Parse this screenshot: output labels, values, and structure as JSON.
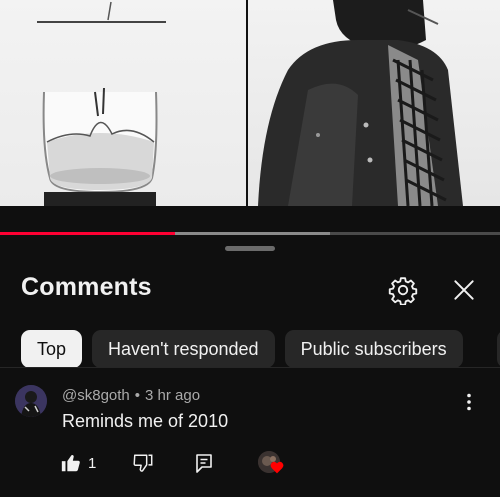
{
  "video": {
    "progress_fraction": 0.35,
    "buffered_fraction": 0.66
  },
  "comments_panel": {
    "title": "Comments",
    "icons": {
      "settings": "gear-icon",
      "close": "close-icon"
    },
    "filters": [
      {
        "label": "Top",
        "selected": true
      },
      {
        "label": "Haven't responded",
        "selected": false
      },
      {
        "label": "Public subscribers",
        "selected": false
      }
    ]
  },
  "comments": [
    {
      "author": "@sk8goth",
      "separator": "•",
      "time": "3 hr ago",
      "text": "Reminds me of 2010",
      "like_count": "1",
      "icons": {
        "like": "thumbs-up-icon",
        "dislike": "thumbs-down-icon",
        "reply": "reply-icon",
        "more": "more-vertical-icon",
        "creator_heart": "creator-heart-icon"
      }
    }
  ],
  "colors": {
    "background": "#0f0f0f",
    "progress": "#ff0033",
    "heart": "#ff0000",
    "chip_selected": "#f1f1f1",
    "chip": "#272727"
  }
}
